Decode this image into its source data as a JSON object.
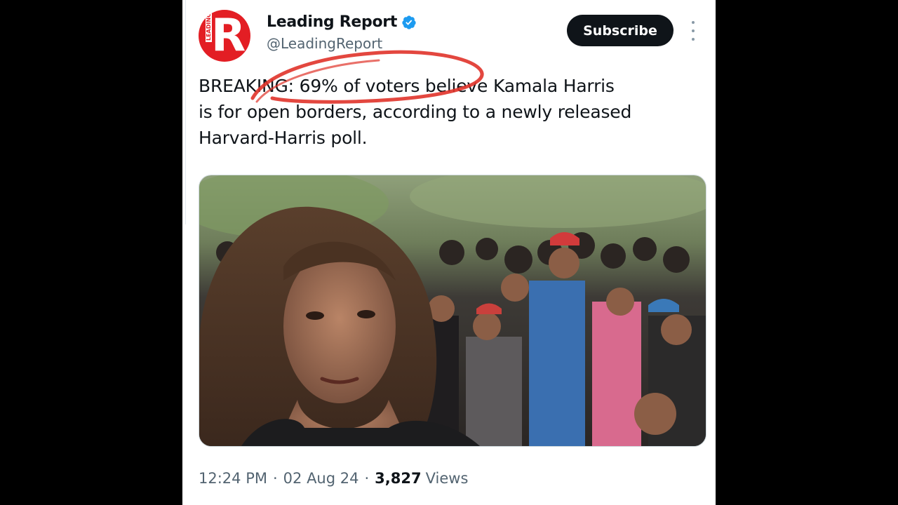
{
  "account": {
    "avatar_letter": "R",
    "avatar_small_text": "LEADING",
    "display_name": "Leading Report",
    "handle": "@LeadingReport",
    "verified": true
  },
  "actions": {
    "subscribe_label": "Subscribe",
    "more_icon": "more-vertical-icon"
  },
  "tweet": {
    "text_line_1": "BREAKING: 69% of voters believe Kamala Harris",
    "text_line_2": "is for open borders, according to a newly released",
    "text_line_3": "Harvard-Harris poll."
  },
  "meta": {
    "time": "12:24 PM",
    "date": "02 Aug 24",
    "separator": "·",
    "views_count": "3,827",
    "views_label": "Views"
  },
  "colors": {
    "brand_red": "#e31e24",
    "verified_blue": "#1d9bf0",
    "button_black": "#0f1419",
    "scribble_red": "#e0332a",
    "secondary_text": "#536471"
  }
}
